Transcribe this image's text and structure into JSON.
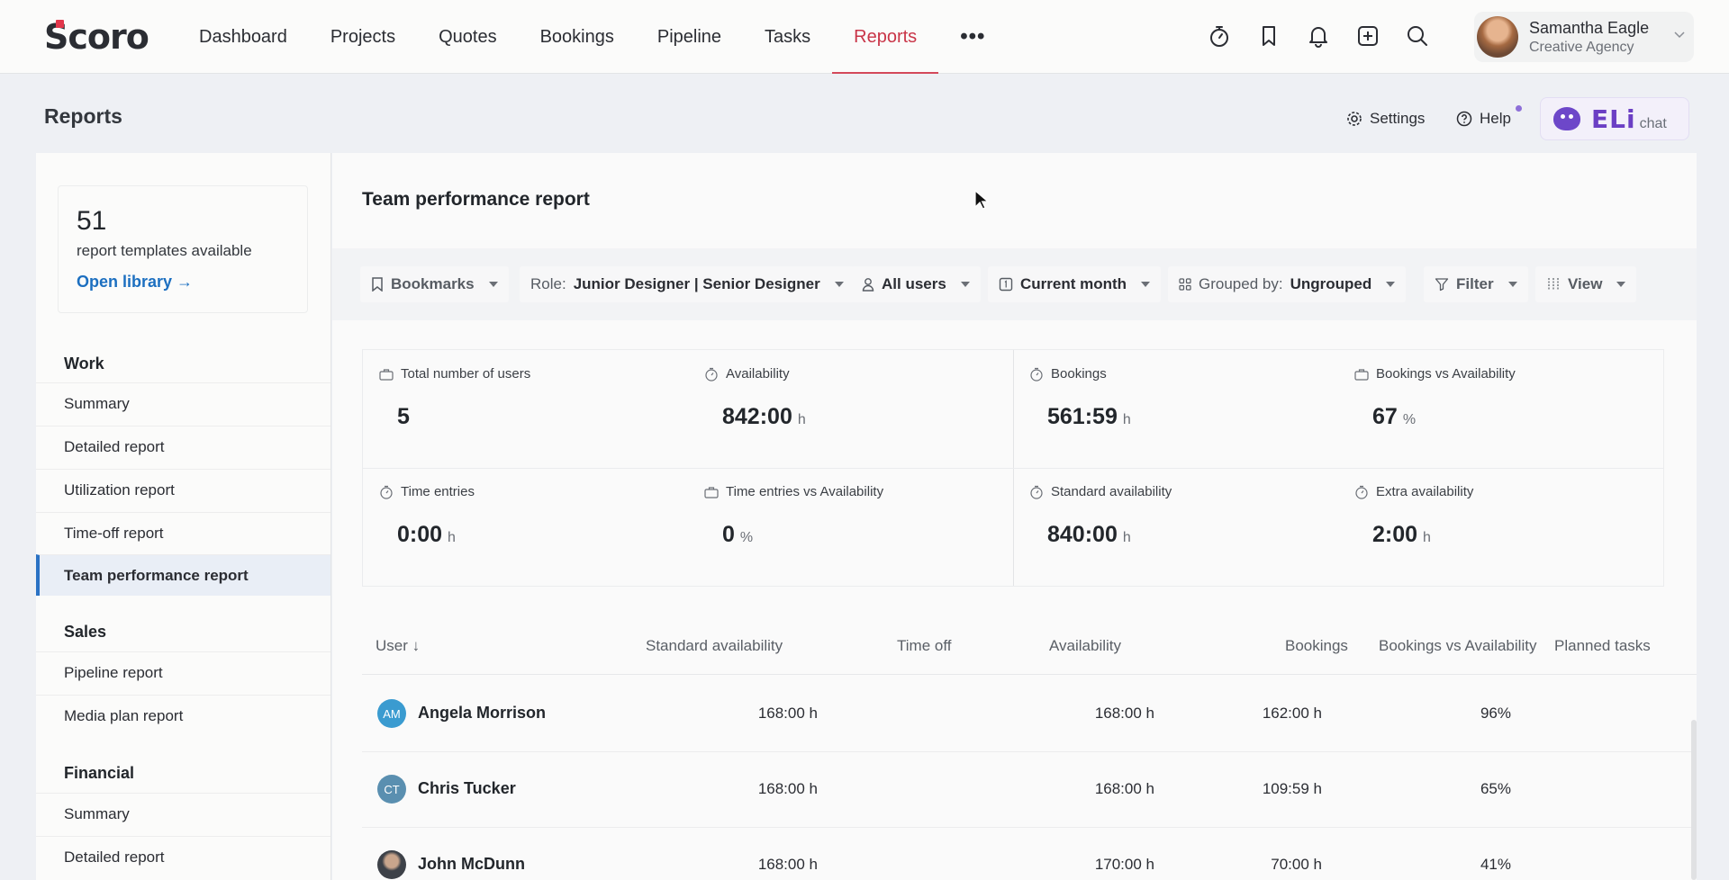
{
  "brand": {
    "logo": "Scoro",
    "accent": "#d3485a"
  },
  "nav": {
    "items": [
      "Dashboard",
      "Projects",
      "Quotes",
      "Bookings",
      "Pipeline",
      "Tasks",
      "Reports"
    ],
    "active": "Reports",
    "more": "•••"
  },
  "user": {
    "name": "Samantha Eagle",
    "org": "Creative Agency"
  },
  "page": {
    "title": "Reports",
    "settings": "Settings",
    "help": "Help",
    "eli": "ELi",
    "eli_chat": "chat"
  },
  "library": {
    "count": "51",
    "text": "report templates available",
    "link": "Open library →"
  },
  "sidebar": {
    "sections": [
      {
        "title": "Work",
        "items": [
          "Summary",
          "Detailed report",
          "Utilization report",
          "Time-off report",
          "Team performance report"
        ]
      },
      {
        "title": "Sales",
        "items": [
          "Pipeline report",
          "Media plan report"
        ]
      },
      {
        "title": "Financial",
        "items": [
          "Summary",
          "Detailed report"
        ]
      }
    ],
    "active": "Team performance report"
  },
  "report": {
    "title": "Team performance report",
    "filters": {
      "bookmarks": "Bookmarks",
      "role_label": "Role:",
      "role_value": "Junior Designer | Senior Designer",
      "users": "All users",
      "period": "Current month",
      "group_label": "Grouped by:",
      "group_value": "Ungrouped",
      "filter": "Filter",
      "view": "View"
    },
    "stats": [
      {
        "label": "Total number of users",
        "value": "5",
        "unit": "",
        "icon": "briefcase-icon"
      },
      {
        "label": "Availability",
        "value": "842:00",
        "unit": "h",
        "icon": "stopwatch-icon"
      },
      {
        "label": "Bookings",
        "value": "561:59",
        "unit": "h",
        "icon": "stopwatch-icon"
      },
      {
        "label": "Bookings vs Availability",
        "value": "67",
        "unit": "%",
        "icon": "briefcase-icon"
      },
      {
        "label": "Time entries",
        "value": "0:00",
        "unit": "h",
        "icon": "stopwatch-icon"
      },
      {
        "label": "Time entries vs Availability",
        "value": "0",
        "unit": "%",
        "icon": "briefcase-icon"
      },
      {
        "label": "Standard availability",
        "value": "840:00",
        "unit": "h",
        "icon": "stopwatch-icon"
      },
      {
        "label": "Extra availability",
        "value": "2:00",
        "unit": "h",
        "icon": "stopwatch-icon"
      }
    ],
    "columns": [
      "User ↓",
      "Standard availability",
      "Time off",
      "Availability",
      "Bookings",
      "Bookings vs Availability",
      "Planned tasks"
    ],
    "rows": [
      {
        "initials": "AM",
        "name": "Angela Morrison",
        "std": "168:00 h",
        "timeoff": "",
        "avail": "168:00 h",
        "bookings": "162:00 h",
        "bva": "96%",
        "avatar_color": "#3a9bd0"
      },
      {
        "initials": "CT",
        "name": "Chris Tucker",
        "std": "168:00 h",
        "timeoff": "",
        "avail": "168:00 h",
        "bookings": "109:59 h",
        "bva": "65%",
        "avatar_color": "#5a8fb0"
      },
      {
        "initials": "",
        "name": "John McDunn",
        "std": "168:00 h",
        "timeoff": "",
        "avail": "170:00 h",
        "bookings": "70:00 h",
        "bva": "41%",
        "avatar_color": "#4a4f57"
      }
    ]
  }
}
